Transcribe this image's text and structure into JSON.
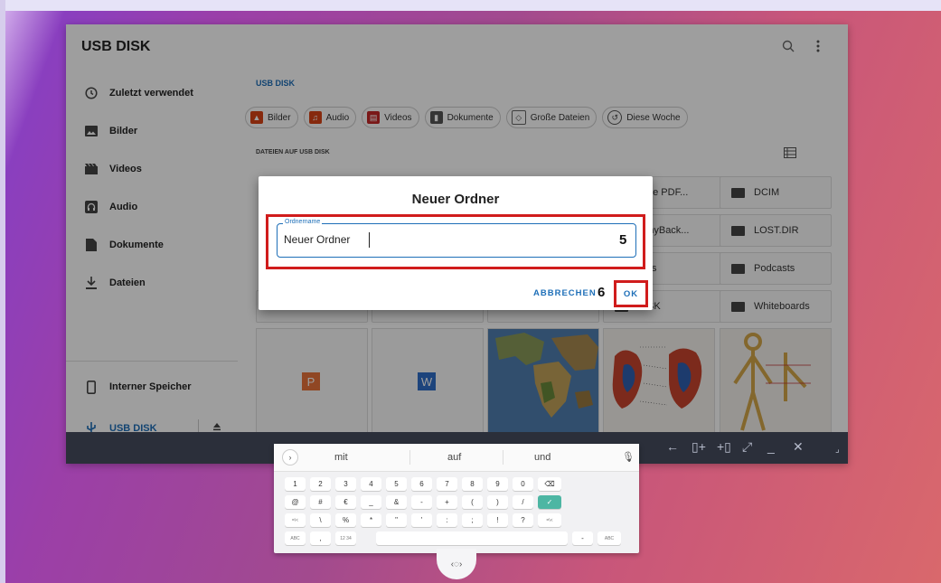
{
  "app": {
    "title": "USB DISK"
  },
  "sidebar": {
    "items": [
      {
        "label": "Zuletzt verwendet",
        "icon": "clock-icon"
      },
      {
        "label": "Bilder",
        "icon": "image-icon"
      },
      {
        "label": "Videos",
        "icon": "film-icon"
      },
      {
        "label": "Audio",
        "icon": "audio-icon"
      },
      {
        "label": "Dokumente",
        "icon": "document-icon"
      },
      {
        "label": "Dateien",
        "icon": "download-icon"
      }
    ],
    "storage": [
      {
        "label": "Interner Speicher",
        "icon": "phone-icon"
      },
      {
        "label": "USB DISK",
        "icon": "usb-icon"
      }
    ]
  },
  "breadcrumb": "USB DISK",
  "chips": [
    {
      "label": "Bilder",
      "icon": "image-icon",
      "color": "#d84315"
    },
    {
      "label": "Audio",
      "icon": "audio-icon",
      "color": "#d84315"
    },
    {
      "label": "Videos",
      "icon": "film-icon",
      "color": "#c62828"
    },
    {
      "label": "Dokumente",
      "icon": "document-icon",
      "color": "#555555"
    },
    {
      "label": "Große Dateien",
      "icon": "tag-icon",
      "color": "#555555"
    },
    {
      "label": "Diese Woche",
      "icon": "history-icon",
      "color": "#555555"
    }
  ],
  "section_label": "DATEIEN AUF USB DISK",
  "files": {
    "col4": [
      "piele PDF...",
      "nonyBack...",
      "ures",
      "DISK"
    ],
    "col5": [
      "DCIM",
      "LOST.DIR",
      "Podcasts",
      "Whiteboards"
    ]
  },
  "thumbs": [
    {
      "name": "powerpoint-file",
      "glyph": "P",
      "color": "#e8733a"
    },
    {
      "name": "word-file",
      "glyph": "W",
      "color": "#2f6fc9"
    }
  ],
  "dialog": {
    "title": "Neuer Ordner",
    "field_label": "Ordnername",
    "field_value": "Neuer Ordner",
    "step_5": "5",
    "step_6": "6",
    "cancel": "ABBRECHEN",
    "ok": "OK"
  },
  "colors": {
    "accent": "#1e6fb8",
    "highlight": "#d01c1c",
    "taskbar": "#2b2f3a"
  },
  "keyboard": {
    "suggestions": [
      "mit",
      "auf",
      "und"
    ],
    "row1": [
      "1",
      "2",
      "3",
      "4",
      "5",
      "6",
      "7",
      "8",
      "9",
      "0"
    ],
    "row2": [
      "@",
      "#",
      "€",
      "_",
      "&",
      "-",
      "+",
      "(",
      ")",
      "/"
    ],
    "row3": [
      "=\\<",
      "\\",
      "%",
      "*",
      "\"",
      "'",
      ":",
      ";",
      "!",
      "?",
      "=\\<"
    ],
    "row4": [
      "ABC",
      ",",
      "12\n34",
      "",
      "-",
      "ABC"
    ]
  }
}
